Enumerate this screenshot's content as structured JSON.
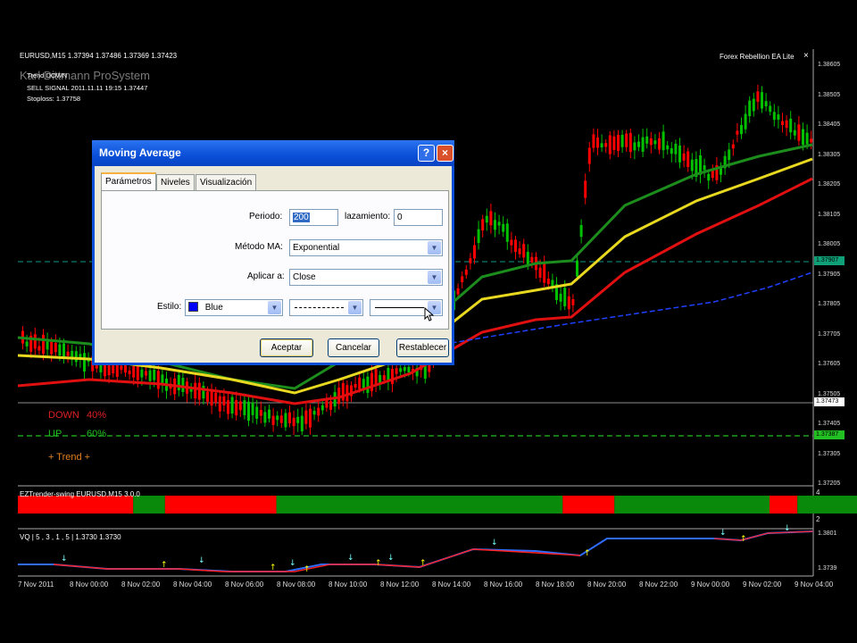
{
  "chart_header": {
    "symbol_line": "EURUSD,M15  1.37394 1.37486 1.37369 1.37423",
    "ea_name": "Forex Rebellion EA Lite",
    "close_x": "×",
    "watermark": "Karl Dittmann ProSystem",
    "trend": "Trend DOWN",
    "sell_signal": "SELL SIGNAL 2011.11.11 19:15 1.37447",
    "stoploss": "Stoploss: 1.37758"
  },
  "price_axis": [
    "1.38605",
    "1.38505",
    "1.38405",
    "1.38305",
    "1.38205",
    "1.38105",
    "1.38005",
    "1.37905",
    "1.37805",
    "1.37705",
    "1.37605",
    "1.37505",
    "1.37405",
    "1.37305",
    "1.37205"
  ],
  "price_tags": [
    {
      "text": "1.37907",
      "color": "#0fa078"
    },
    {
      "text": "1.37473",
      "color": "#ffffff"
    },
    {
      "text": "1.37387",
      "color": "#22c022"
    }
  ],
  "signal_box": {
    "down_label": "DOWN",
    "down_value": "40%",
    "up_label": "UP",
    "up_value": "60%",
    "trend_label": "+   Trend   +"
  },
  "indicator_1": {
    "name": "EZTrender-swing EURUSD,M15 3.0.0",
    "scale_top": "4",
    "scale_bottom": "2",
    "segments": [
      {
        "color": "red",
        "w": 0.145
      },
      {
        "color": "green",
        "w": 0.04
      },
      {
        "color": "red",
        "w": 0.14
      },
      {
        "color": "green",
        "w": 0.36
      },
      {
        "color": "red",
        "w": 0.065
      },
      {
        "color": "green",
        "w": 0.195
      },
      {
        "color": "red",
        "w": 0.035
      },
      {
        "color": "green",
        "w": 0.08
      },
      {
        "color": "red",
        "w": 0.02
      }
    ]
  },
  "indicator_2": {
    "name": "VQ | 5 , 3 , 1 , 5  |  1.3730  1.3730",
    "scale_top": "1.3801",
    "scale_bottom": "1.3739"
  },
  "time_axis": [
    "7 Nov 2011",
    "8 Nov 00:00",
    "8 Nov 02:00",
    "8 Nov 04:00",
    "8 Nov 06:00",
    "8 Nov 08:00",
    "8 Nov 10:00",
    "8 Nov 12:00",
    "8 Nov 14:00",
    "8 Nov 16:00",
    "8 Nov 18:00",
    "8 Nov 20:00",
    "8 Nov 22:00",
    "9 Nov 00:00",
    "9 Nov 02:00",
    "9 Nov 04:00"
  ],
  "dialog": {
    "title": "Moving Average",
    "help_icon": "?",
    "close_icon": "×",
    "tabs": [
      "Parámetros",
      "Niveles",
      "Visualización"
    ],
    "period_label": "Periodo:",
    "period_value": "200",
    "shift_label": "lazamiento:",
    "shift_value": "0",
    "method_label": "Método MA:",
    "method_value": "Exponential",
    "apply_label": "Aplicar a:",
    "apply_value": "Close",
    "style_label": "Estilo:",
    "color_value": "Blue",
    "color_swatch": "#0000ff",
    "buttons": {
      "ok": "Aceptar",
      "cancel": "Cancelar",
      "reset": "Restablecer"
    }
  },
  "colors": {
    "bull": "#00c000",
    "bear": "#ff0000",
    "ma_green": "#1c8c1c",
    "ma_yellow": "#e8d820",
    "ma_red": "#e01010",
    "ma_blue": "#2040ff",
    "dash_teal": "#0e7a6e",
    "dash_green": "#20c020"
  }
}
